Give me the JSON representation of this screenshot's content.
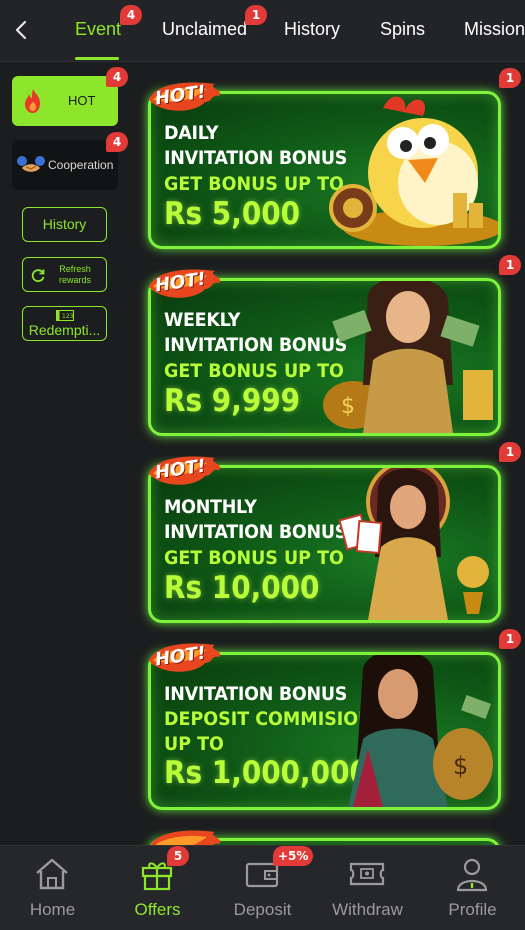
{
  "tabs": [
    {
      "label": "Event",
      "badge": "4",
      "active": true
    },
    {
      "label": "Unclaimed",
      "badge": "1"
    },
    {
      "label": "History"
    },
    {
      "label": "Spins"
    },
    {
      "label": "Mission"
    }
  ],
  "sidebar": {
    "hot": {
      "label": "HOT",
      "badge": "4"
    },
    "cooperation": {
      "label": "Cooperation",
      "badge": "4"
    },
    "history_label": "History",
    "refresh_label_1": "Refresh",
    "refresh_label_2": "rewards",
    "redemption_label": "Redempti..."
  },
  "banners": [
    {
      "hot": "HOT!",
      "badge": "1",
      "line1": "DAILY",
      "line2": "INVITATION BONUS",
      "line3": "GET BONUS UP TO",
      "amount": "Rs 5,000"
    },
    {
      "hot": "HOT!",
      "badge": "1",
      "line1": "WEEKLY",
      "line2": "INVITATION BONUS",
      "line3": "GET BONUS UP TO",
      "amount": "Rs 9,999"
    },
    {
      "hot": "HOT!",
      "badge": "1",
      "line1": "MONTHLY",
      "line2": "INVITATION BONUS",
      "line3": "GET BONUS UP TO",
      "amount": "Rs 10,000"
    },
    {
      "hot": "HOT!",
      "badge": "1",
      "line1": "INVITATION BONUS",
      "line2": "DEPOSIT COMMISION",
      "line3": "UP TO",
      "amount": "Rs 1,000,000"
    }
  ],
  "bottom_nav": {
    "home": "Home",
    "offers": "Offers",
    "offers_badge": "5",
    "deposit": "Deposit",
    "deposit_badge": "+5%",
    "withdraw": "Withdraw",
    "profile": "Profile"
  },
  "colors": {
    "accent": "#8ee62c",
    "badge": "#e23b37",
    "background": "#1c1d1f",
    "banner_glow": "#7ff23a"
  }
}
